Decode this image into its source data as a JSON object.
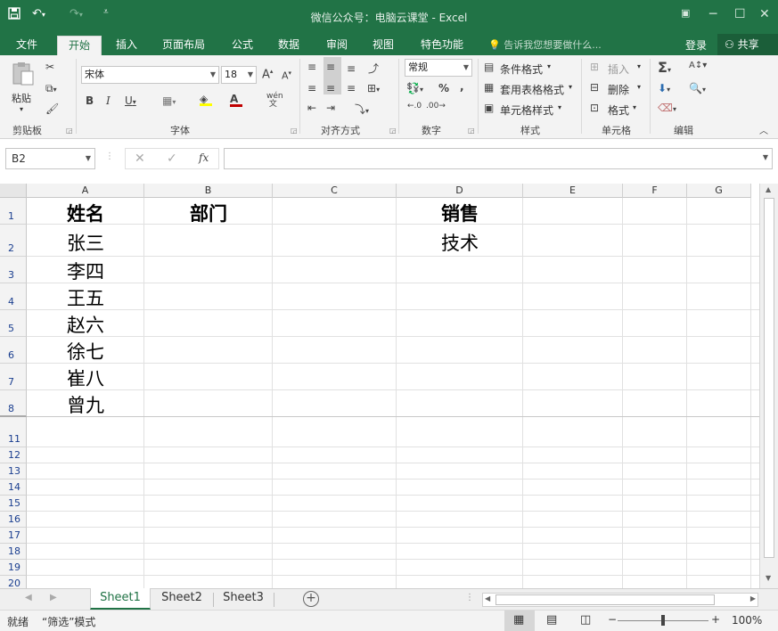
{
  "window": {
    "title": "微信公众号：电脑云课堂 - Excel",
    "qat": {
      "save_icon": "save-icon",
      "undo_icon": "undo-icon",
      "redo_icon": "redo-icon",
      "customize_icon": "customize-qat-icon"
    }
  },
  "tabs": [
    "文件",
    "开始",
    "插入",
    "页面布局",
    "公式",
    "数据",
    "审阅",
    "视图",
    "特色功能"
  ],
  "active_tab": "开始",
  "tell_me": "告诉我您想要做什么...",
  "login": "登录",
  "share": "共享",
  "ribbon": {
    "clipboard": {
      "label": "剪贴板",
      "paste": "粘贴"
    },
    "font": {
      "label": "字体",
      "name": "宋体",
      "size": "18",
      "grow": "A",
      "shrink": "A",
      "bold": "B",
      "italic": "I",
      "underline": "U",
      "phonetic": "wén"
    },
    "alignment": {
      "label": "对齐方式"
    },
    "number": {
      "label": "数字",
      "format": "常规",
      "percent": "%",
      "comma": ","
    },
    "styles": {
      "label": "样式",
      "conditional": "条件格式",
      "table": "套用表格格式",
      "cell": "单元格样式"
    },
    "cells": {
      "label": "单元格",
      "insert": "插入",
      "delete": "删除",
      "format": "格式"
    },
    "editing": {
      "label": "编辑"
    }
  },
  "formula_bar": {
    "name_box": "B2",
    "fx": "fx",
    "formula": ""
  },
  "columns": [
    "A",
    "B",
    "C",
    "D",
    "E",
    "F",
    "G"
  ],
  "rows": [
    "1",
    "2",
    "3",
    "4",
    "5",
    "6",
    "7",
    "8",
    "11",
    "12",
    "13",
    "14",
    "15",
    "16",
    "17",
    "18",
    "19",
    "20"
  ],
  "cells": {
    "A1": "姓名",
    "B1": "部门",
    "D1": "销售",
    "D2": "技术",
    "A2": "张三",
    "A3": "李四",
    "A4": "王五",
    "A5": "赵六",
    "A6": "徐七",
    "A7": "崔八",
    "A8": "曾九"
  },
  "sheets": [
    "Sheet1",
    "Sheet2",
    "Sheet3"
  ],
  "active_sheet": "Sheet1",
  "status": {
    "ready": "就绪",
    "mode": "“筛选”模式",
    "zoom": "100%",
    "zoom_minus": "−",
    "zoom_plus": "+"
  },
  "colors": {
    "excel_green": "#217346",
    "ribbon_bg": "#f3f3f3"
  }
}
